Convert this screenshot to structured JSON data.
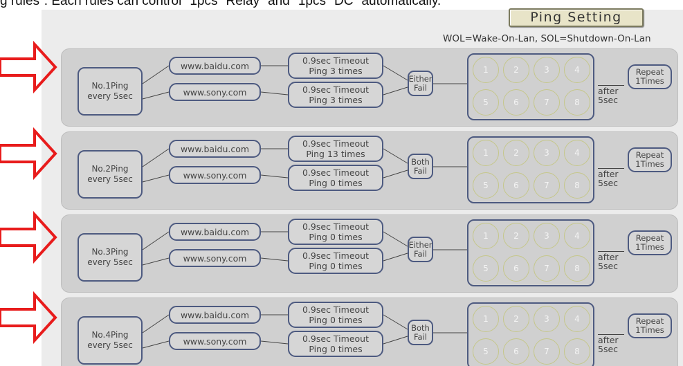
{
  "header": {
    "top_text": "g rules\". Each rules can control \"1pcs\" Relay\" and \"1pcs\" DC\" automatically.",
    "ping_setting_button": "Ping Setting",
    "legend": "WOL=Wake-On-Lan, SOL=Shutdown-On-Lan"
  },
  "colors": {
    "arrow": "#e81c1c",
    "panel_border": "#4d5a80",
    "rule_bg": "#d0d0d0",
    "relay_circle": "#c5c78a"
  },
  "relay_labels": [
    "1",
    "2",
    "3",
    "4",
    "5",
    "6",
    "7",
    "8"
  ],
  "rules": [
    {
      "ping_line1": "No.1Ping",
      "ping_line2": "every 5sec",
      "host1": "www.baidu.com",
      "host2": "www.sony.com",
      "t1_line1": "0.9sec Timeout",
      "t1_line2": "Ping 3 times",
      "t2_line1": "0.9sec Timeout",
      "t2_line2": "Ping 3 times",
      "fail_line1": "Either",
      "fail_line2": "Fail",
      "after": "after",
      "delay": "5sec",
      "repeat_line1": "Repeat",
      "repeat_line2": "1Times"
    },
    {
      "ping_line1": "No.2Ping",
      "ping_line2": "every 5sec",
      "host1": "www.baidu.com",
      "host2": "www.sony.com",
      "t1_line1": "0.9sec Timeout",
      "t1_line2": "Ping 13 times",
      "t2_line1": "0.9sec Timeout",
      "t2_line2": "Ping 0 times",
      "fail_line1": "Both",
      "fail_line2": "Fail",
      "after": "after",
      "delay": "5sec",
      "repeat_line1": "Repeat",
      "repeat_line2": "1Times"
    },
    {
      "ping_line1": "No.3Ping",
      "ping_line2": "every 5sec",
      "host1": "www.baidu.com",
      "host2": "www.sony.com",
      "t1_line1": "0.9sec Timeout",
      "t1_line2": "Ping 0 times",
      "t2_line1": "0.9sec Timeout",
      "t2_line2": "Ping 0 times",
      "fail_line1": "Either",
      "fail_line2": "Fail",
      "after": "after",
      "delay": "5sec",
      "repeat_line1": "Repeat",
      "repeat_line2": "1Times"
    },
    {
      "ping_line1": "No.4Ping",
      "ping_line2": "every 5sec",
      "host1": "www.baidu.com",
      "host2": "www.sony.com",
      "t1_line1": "0.9sec Timeout",
      "t1_line2": "Ping 0 times",
      "t2_line1": "0.9sec Timeout",
      "t2_line2": "Ping 0 times",
      "fail_line1": "Both",
      "fail_line2": "Fail",
      "after": "after",
      "delay": "5sec",
      "repeat_line1": "Repeat",
      "repeat_line2": "1Times"
    }
  ]
}
